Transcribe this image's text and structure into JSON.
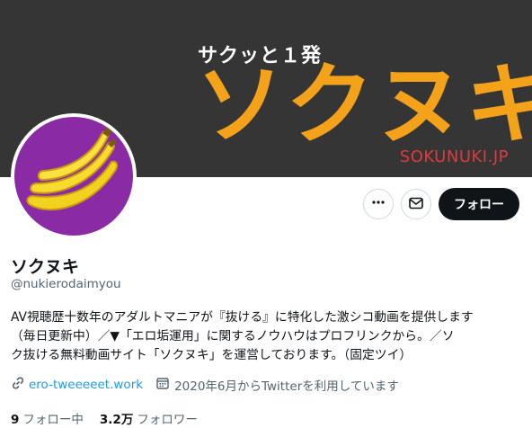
{
  "banner": {
    "tagline": "サクッと１発",
    "logo": "ソクヌキ",
    "url": "SOKUNUKI.JP"
  },
  "actions": {
    "more_icon": "more-icon",
    "message_icon": "mail-icon",
    "follow_label": "フォロー"
  },
  "profile": {
    "name": "ソクヌキ",
    "handle": "@nukierodaimyou",
    "bio_line1": "AV視聴歴十数年のアダルトマニアが『抜ける』に特化した激シコ動画を提供します",
    "bio_line2": "（毎日更新中）／▼「エロ垢運用」に関するノウハウはプロフリンクから。／ソ",
    "bio_line3": "ク抜ける無料動画サイト「ソクヌキ」を運営しております。（固定ツイ）",
    "link": "ero-tweeeeet.work",
    "joined": "2020年6月からTwitterを利用しています"
  },
  "stats": {
    "following_count": "9",
    "following_label": "フォロー中",
    "followers_count": "3.2万",
    "followers_label": "フォロワー"
  },
  "colors": {
    "banner_bg": "#353535",
    "logo_orange": "#f5a21b",
    "url_red": "#e23a3a",
    "avatar_purple": "#8a2aa5",
    "link_blue": "#1d9bf0"
  }
}
